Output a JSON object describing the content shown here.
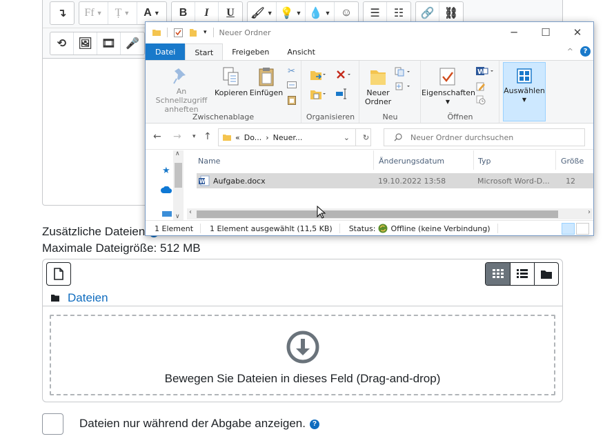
{
  "moodle": {
    "toolbar_row1": {
      "font_family_label": "Ff",
      "font_size_label": "Ṭ",
      "font_color_label": "A",
      "bold_label": "B",
      "italic_label": "I",
      "underline_label": "U"
    },
    "additional_files_label": "Zusätzliche Dateien",
    "max_file_size_label": "Maximale Dateigröße: 512 MB",
    "filemanager": {
      "path_label": "Dateien",
      "drop_text": "Bewegen Sie Dateien in dieses Feld (Drag-and-drop)"
    },
    "checkbox_label": "Dateien nur während der Abgabe anzeigen.",
    "help_symbol": "?",
    "colors": {
      "accent": "#0f6cbf",
      "border": "#c7c9cc",
      "text": "#1d2125"
    }
  },
  "explorer": {
    "title": "Neuer Ordner",
    "window_controls": {
      "minimize": "─",
      "maximize": "☐",
      "close": "✕"
    },
    "ribbon_tabs": [
      "Datei",
      "Start",
      "Freigeben",
      "Ansicht"
    ],
    "active_tab": "Start",
    "help_symbol": "?",
    "collapse_symbol": "^",
    "ribbon": {
      "clipboard": {
        "group_name": "Zwischenablage",
        "pin_label": "An Schnellzugriff anheften",
        "copy_label": "Kopieren",
        "paste_label": "Einfügen"
      },
      "organize": {
        "group_name": "Organisieren"
      },
      "new": {
        "group_name": "Neu",
        "new_folder_label": "Neuer Ordner"
      },
      "open": {
        "group_name": "Öffnen",
        "properties_label": "Eigenschaften"
      },
      "select": {
        "select_label": "Auswählen"
      }
    },
    "address": {
      "breadcrumb_prefix": "«",
      "crumb1": "Do...",
      "crumb2": "Neuer...",
      "separator": "›",
      "search_placeholder": "Neuer Ordner durchsuchen"
    },
    "columns": [
      "Name",
      "Änderungsdatum",
      "Typ",
      "Größe"
    ],
    "files": [
      {
        "name": "Aufgabe.docx",
        "modified": "19.10.2022 13:58",
        "type": "Microsoft Word-D...",
        "size": "12"
      }
    ],
    "status": {
      "count": "1 Element",
      "selected": "1 Element ausgewählt (11,5 KB)",
      "status_prefix": "Status:",
      "status_value": "Offline (keine Verbindung)"
    },
    "colors": {
      "file_tab": "#1979ca",
      "select_bg": "#cde8ff",
      "selected_row": "#d9d9d9",
      "folder": "#f4c44f",
      "word_blue": "#2b579a"
    }
  }
}
